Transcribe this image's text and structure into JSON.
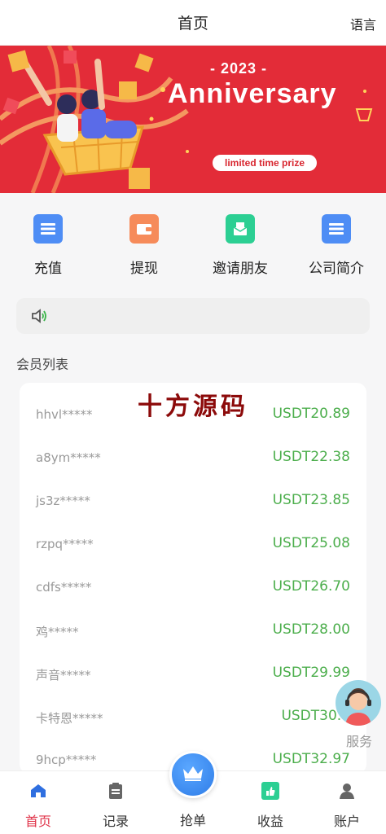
{
  "header": {
    "title": "首页",
    "language": "语言"
  },
  "banner": {
    "year": "- 2023 -",
    "headline": "Anniversary",
    "tag": "limited time prize"
  },
  "quick_actions": [
    {
      "label": "充值",
      "icon": "recharge-icon",
      "color": "#4e8df5"
    },
    {
      "label": "提现",
      "icon": "wallet-icon",
      "color": "#f68b5a"
    },
    {
      "label": "邀请朋友",
      "icon": "invite-icon",
      "color": "#2ccf93"
    },
    {
      "label": "公司简介",
      "icon": "company-icon",
      "color": "#4e8df5"
    }
  ],
  "notice": {
    "icon": "speaker-icon",
    "text": ""
  },
  "members": {
    "title": "会员列表",
    "watermark": "十方源码",
    "rows": [
      {
        "name": "hhvl*****",
        "amount": "USDT20.89"
      },
      {
        "name": "a8ym*****",
        "amount": "USDT22.38"
      },
      {
        "name": "js3z*****",
        "amount": "USDT23.85"
      },
      {
        "name": "rzpq*****",
        "amount": "USDT25.08"
      },
      {
        "name": "cdfs*****",
        "amount": "USDT26.70"
      },
      {
        "name": "鸡*****",
        "amount": "USDT28.00"
      },
      {
        "name": "声音*****",
        "amount": "USDT29.99"
      },
      {
        "name": "卡特恩*****",
        "amount": "USDT30.0"
      },
      {
        "name": "9hcp*****",
        "amount": "USDT32.97"
      }
    ]
  },
  "service": {
    "label": "服务"
  },
  "tabbar": {
    "home": "首页",
    "records": "记录",
    "grab": "抢单",
    "earnings": "收益",
    "account": "账户"
  },
  "colors": {
    "accent_red": "#e0344a",
    "amount_green": "#4cae4c",
    "banner_red": "#e32c38",
    "center_blue": "#2f7de8"
  }
}
